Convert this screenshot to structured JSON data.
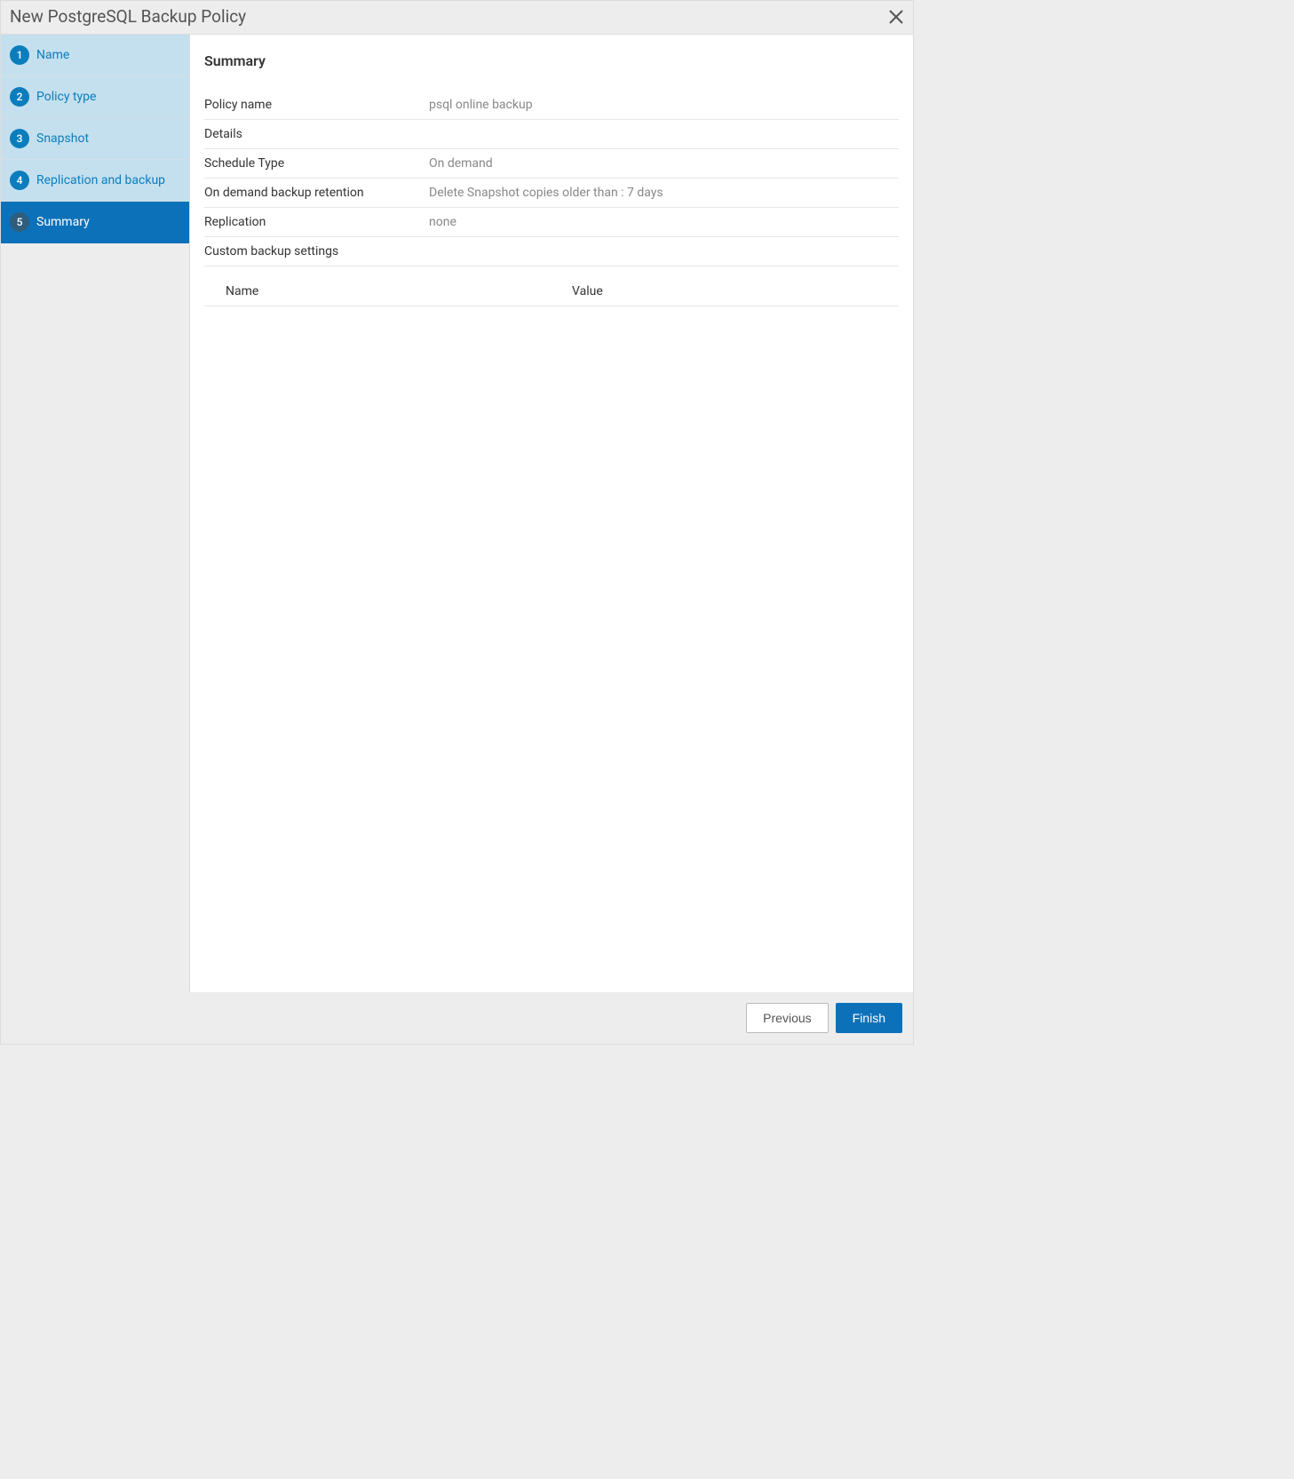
{
  "title": "New PostgreSQL Backup Policy",
  "steps": [
    {
      "num": "1",
      "label": "Name"
    },
    {
      "num": "2",
      "label": "Policy type"
    },
    {
      "num": "3",
      "label": "Snapshot"
    },
    {
      "num": "4",
      "label": "Replication and backup"
    },
    {
      "num": "5",
      "label": "Summary"
    }
  ],
  "main": {
    "heading": "Summary",
    "rows": {
      "policy_name_label": "Policy name",
      "policy_name_value": "psql online backup",
      "details_label": "Details",
      "schedule_type_label": "Schedule Type",
      "schedule_type_value": "On demand",
      "retention_label": "On demand backup retention",
      "retention_value": "Delete Snapshot copies older than : 7 days",
      "replication_label": "Replication",
      "replication_value": "none",
      "custom_settings_label": "Custom backup settings"
    },
    "table": {
      "col_name": "Name",
      "col_value": "Value"
    }
  },
  "footer": {
    "previous": "Previous",
    "finish": "Finish"
  }
}
